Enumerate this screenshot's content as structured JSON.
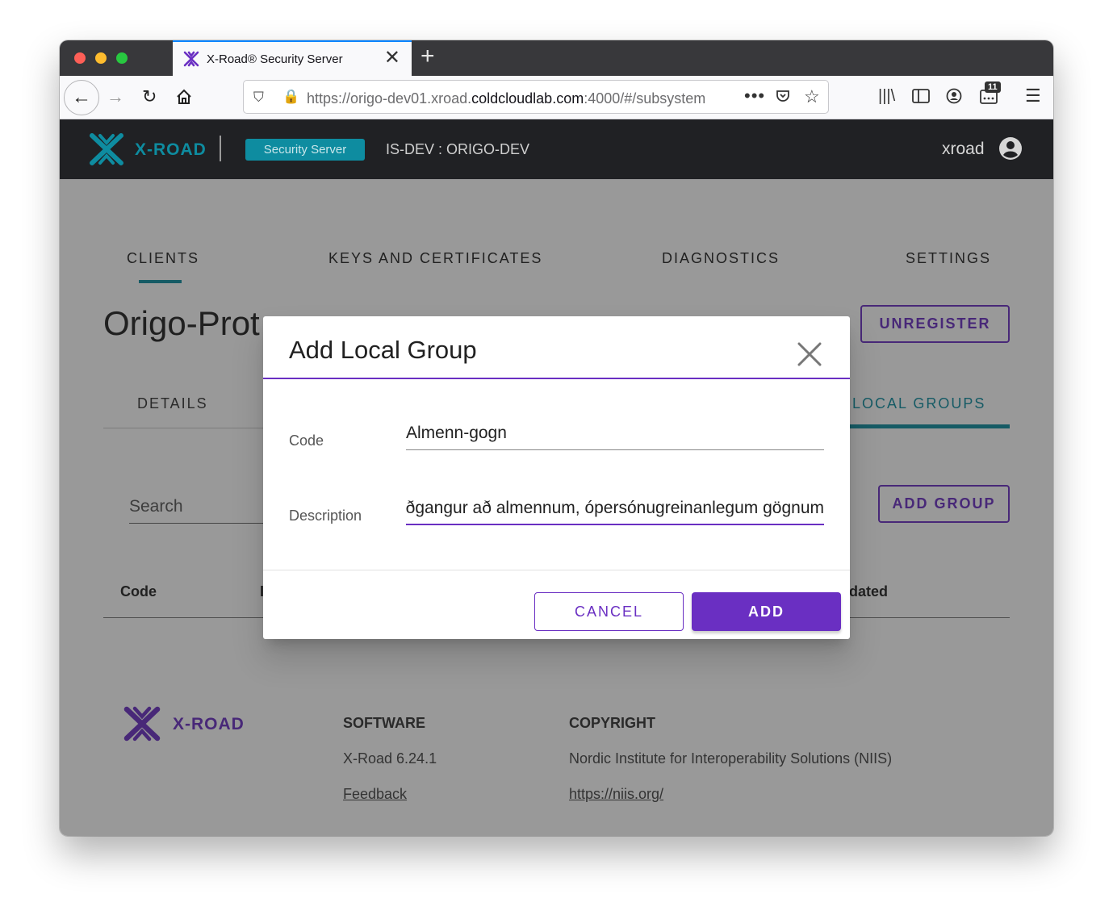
{
  "browser": {
    "tab_title": "X-Road® Security Server",
    "new_tab": "+",
    "tab_close": "✕",
    "url_prefix": "https://origo-dev01.xroad.",
    "url_domain": "coldcloudlab.com",
    "url_suffix": ":4000/#/subsystem",
    "url_more": "•••",
    "extensions_badge": "11"
  },
  "header": {
    "logo_text": "X-ROAD",
    "product_chip": "Security Server",
    "server_id": "IS-DEV : ORIGO-DEV",
    "user_name": "xroad"
  },
  "main_tabs": [
    "CLIENTS",
    "KEYS AND CERTIFICATES",
    "DIAGNOSTICS",
    "SETTINGS"
  ],
  "page": {
    "title": "Origo-Prot",
    "unregister_label": "UNREGISTER",
    "sub_tabs": {
      "details": "DETAILS",
      "local_groups": "LOCAL GROUPS"
    },
    "search_label": "Search",
    "add_group_label": "ADD GROUP",
    "columns": {
      "code": "Code",
      "description": "I",
      "updated": "dated"
    }
  },
  "footer": {
    "logo_text": "X-ROAD",
    "software_heading": "SOFTWARE",
    "version": "X-Road 6.24.1",
    "feedback": "Feedback",
    "copyright_heading": "COPYRIGHT",
    "org": "Nordic Institute for Interoperability Solutions (NIIS)",
    "org_url": "https://niis.org/"
  },
  "dialog": {
    "title": "Add Local Group",
    "code_label": "Code",
    "code_value": "Almenn-gogn",
    "description_label": "Description",
    "description_value": "ðgangur að almennum, ópersónugreinanlegum gögnum",
    "cancel_label": "CANCEL",
    "add_label": "ADD"
  },
  "colors": {
    "accent_purple": "#6a2fc2",
    "teal": "#0e8ca0",
    "header_bg": "#202124"
  }
}
